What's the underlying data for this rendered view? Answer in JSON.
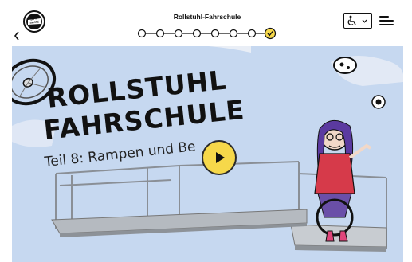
{
  "header": {
    "title": "Rollstuhl-Fahrschule",
    "logo_text": "SIT'N SKATE",
    "steps_total": 8,
    "steps_completed": 8
  },
  "video": {
    "headline_line1": "ROLLSTUHL",
    "headline_line2": "FAHRSCHULE",
    "subtitle": "Teil 8: Rampen und Be"
  },
  "colors": {
    "accent": "#f6d84a",
    "video_bg": "#c6d8f0",
    "ink": "#111111"
  },
  "icons": {
    "back": "chevron-left-icon",
    "language": "wheelchair-icon",
    "menu": "menu-icon",
    "play": "play-icon",
    "check": "check-icon"
  }
}
